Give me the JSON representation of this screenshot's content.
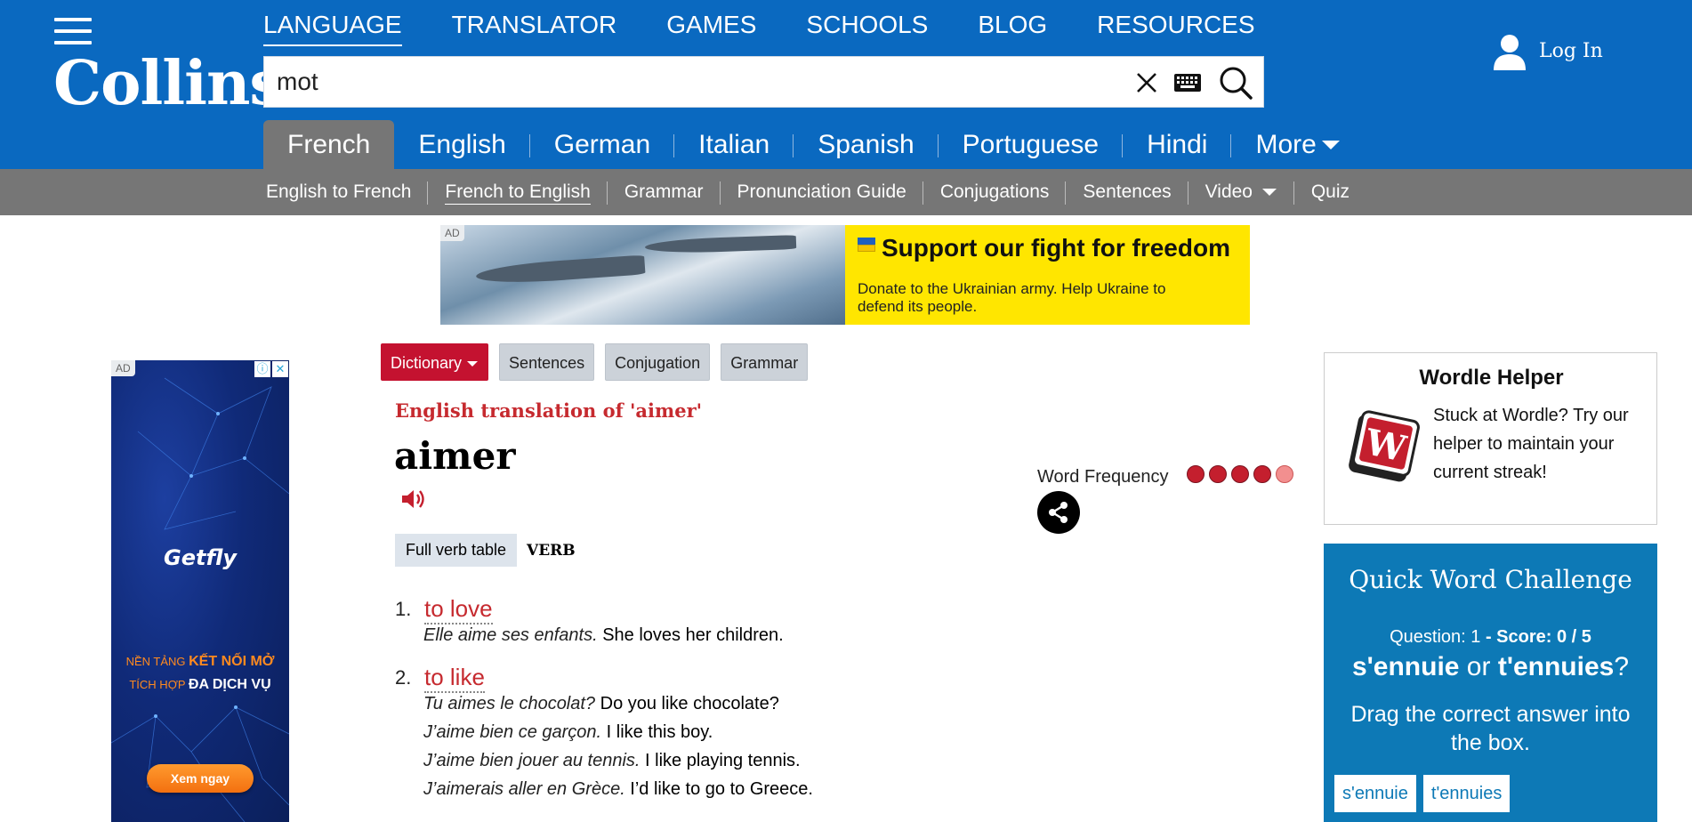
{
  "header": {
    "logo": "Collins",
    "nav": [
      "LANGUAGE",
      "TRANSLATOR",
      "GAMES",
      "SCHOOLS",
      "BLOG",
      "RESOURCES"
    ],
    "search_value": "mot",
    "login_label": "Log In",
    "brand_color": "#0a69c0"
  },
  "lang_tabs": [
    "French",
    "English",
    "German",
    "Italian",
    "Spanish",
    "Portuguese",
    "Hindi",
    "More"
  ],
  "sub_nav": [
    "English to French",
    "French to English",
    "Grammar",
    "Pronunciation Guide",
    "Conjugations",
    "Sentences",
    "Video",
    "Quiz"
  ],
  "top_ad": {
    "tag": "AD",
    "headline": "Support our fight for freedom",
    "body": "Donate to the Ukrainian army. Help Ukraine to defend its people."
  },
  "left_ad": {
    "tag": "AD",
    "brand": "Getfly",
    "line1_a": "NỀN TẢNG ",
    "line1_b": "KẾT NỐI MỞ",
    "line2_a": "TÍCH HỢP ",
    "line2_b": "ĐA DỊCH VỤ",
    "cta": "Xem ngay",
    "info": "ⓘ",
    "close": "✕"
  },
  "content_tabs": [
    "Dictionary",
    "Sentences",
    "Conjugation",
    "Grammar"
  ],
  "entry": {
    "translation_heading": "English translation of  'aimer'",
    "headword": "aimer",
    "full_verb_table": "Full verb table",
    "pos": "VERB",
    "senses": [
      {
        "num": "1.",
        "translation": "to love",
        "examples": [
          {
            "fr": "Elle aime ses enfants.",
            "en": " She loves her children."
          }
        ]
      },
      {
        "num": "2.",
        "translation": "to like",
        "examples": [
          {
            "fr": "Tu aimes le chocolat?",
            "en": " Do you like chocolate?"
          },
          {
            "fr": "J’aime bien ce garçon.",
            "en": " I like this boy."
          },
          {
            "fr": "J’aime bien jouer au tennis.",
            "en": " I like playing tennis."
          },
          {
            "fr": "J’aimerais aller en Grèce.",
            "en": " I’d like to go to Greece."
          }
        ]
      }
    ],
    "word_frequency_label": "Word Frequency"
  },
  "wordle": {
    "title": "Wordle Helper",
    "text": "Stuck at Wordle? Try our helper to maintain your current streak!"
  },
  "quick_word": {
    "title": "Quick Word Challenge",
    "question_label": "Question: 1",
    "separator": " - ",
    "score": "Score: 0 / 5",
    "option_a": "s'ennuie",
    "or": " or ",
    "option_b": "t'ennuies",
    "qmark": "?",
    "instruction": "Drag the correct answer into the box.",
    "choices": [
      "s'ennuie",
      "t'ennuies"
    ]
  }
}
